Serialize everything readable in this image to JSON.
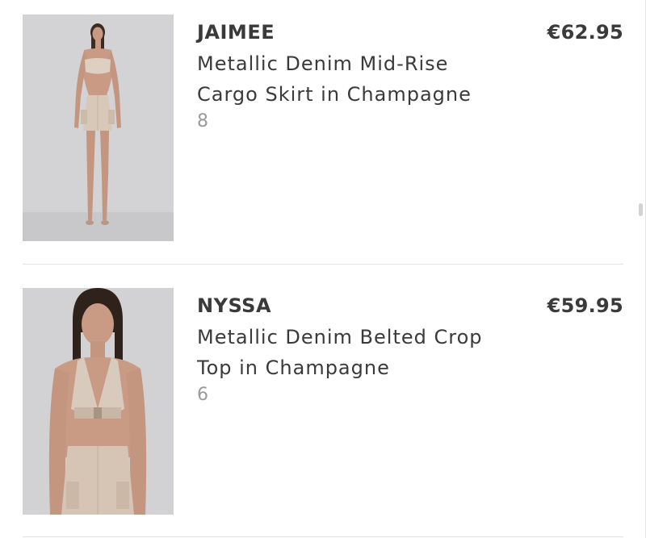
{
  "cart": {
    "items": [
      {
        "brand": "JAIMEE",
        "name_line1": "Metallic Denim Mid-Rise",
        "name_line2": "Cargo Skirt in Champagne",
        "size": "8",
        "price": "€62.95",
        "image_alt": "Model wearing champagne metallic bandeau top and mini cargo skirt"
      },
      {
        "brand": "NYSSA",
        "name_line1": "Metallic Denim Belted Crop",
        "name_line2": "Top in Champagne",
        "size": "6",
        "price": "€59.95",
        "image_alt": "Model wearing champagne metallic halter crop top with belt"
      }
    ]
  },
  "colors": {
    "text": "#3a3a3a",
    "muted": "#9a9a9a",
    "divider": "#e3e3e3",
    "photo_bg": "#d2d2d4",
    "garment": "#d9c6b2"
  }
}
